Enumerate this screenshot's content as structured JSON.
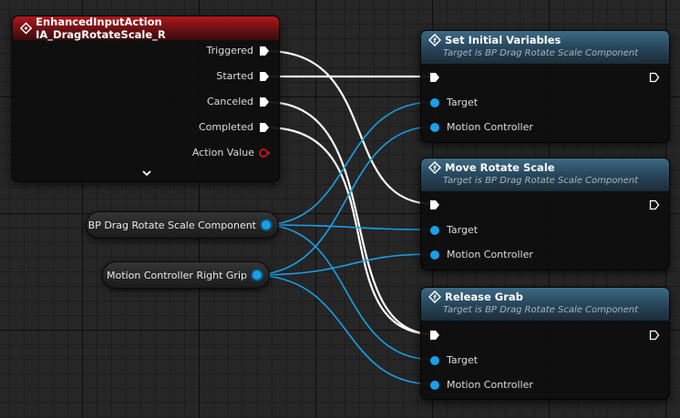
{
  "event_node": {
    "title": "EnhancedInputAction IA_DragRotateScale_R",
    "outputs": [
      "Triggered",
      "Started",
      "Canceled",
      "Completed"
    ],
    "action_value_label": "Action Value",
    "header_color": "#8b1214"
  },
  "variables": {
    "drag_component_label": "BP Drag Rotate Scale Component",
    "motion_controller_label": "Motion Controller Right Grip"
  },
  "function_nodes": [
    {
      "title": "Set Initial Variables",
      "subtitle": "Target is BP Drag Rotate Scale Component",
      "target_label": "Target",
      "controller_label": "Motion Controller"
    },
    {
      "title": "Move Rotate Scale",
      "subtitle": "Target is BP Drag Rotate Scale Component",
      "target_label": "Target",
      "controller_label": "Motion Controller"
    },
    {
      "title": "Release Grab",
      "subtitle": "Target is BP Drag Rotate Scale Component",
      "target_label": "Target",
      "controller_label": "Motion Controller"
    }
  ],
  "colors": {
    "object_pin": "#1aa0e8",
    "exec_wire": "#ffffff",
    "function_header": "#2c4f66"
  },
  "icons": {
    "function": "function-f-icon",
    "exec": "exec-arrow-icon",
    "collapse": "chevron-down-icon"
  }
}
